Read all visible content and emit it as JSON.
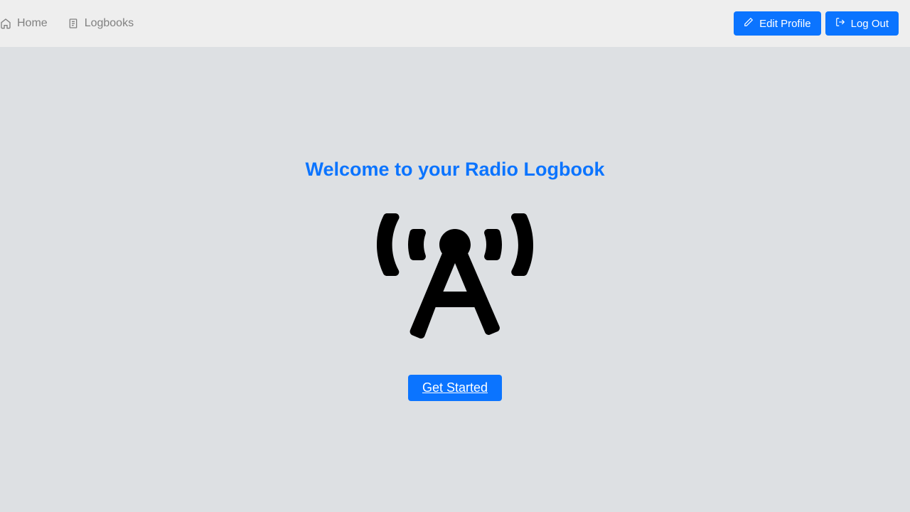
{
  "nav": {
    "left": [
      {
        "label": "Home"
      },
      {
        "label": "Logbooks"
      }
    ],
    "right": {
      "edit": "Edit Profile",
      "logout": "Log Out"
    }
  },
  "hero": {
    "title": "Welcome to your Radio Logbook",
    "cta": "Get Started"
  }
}
